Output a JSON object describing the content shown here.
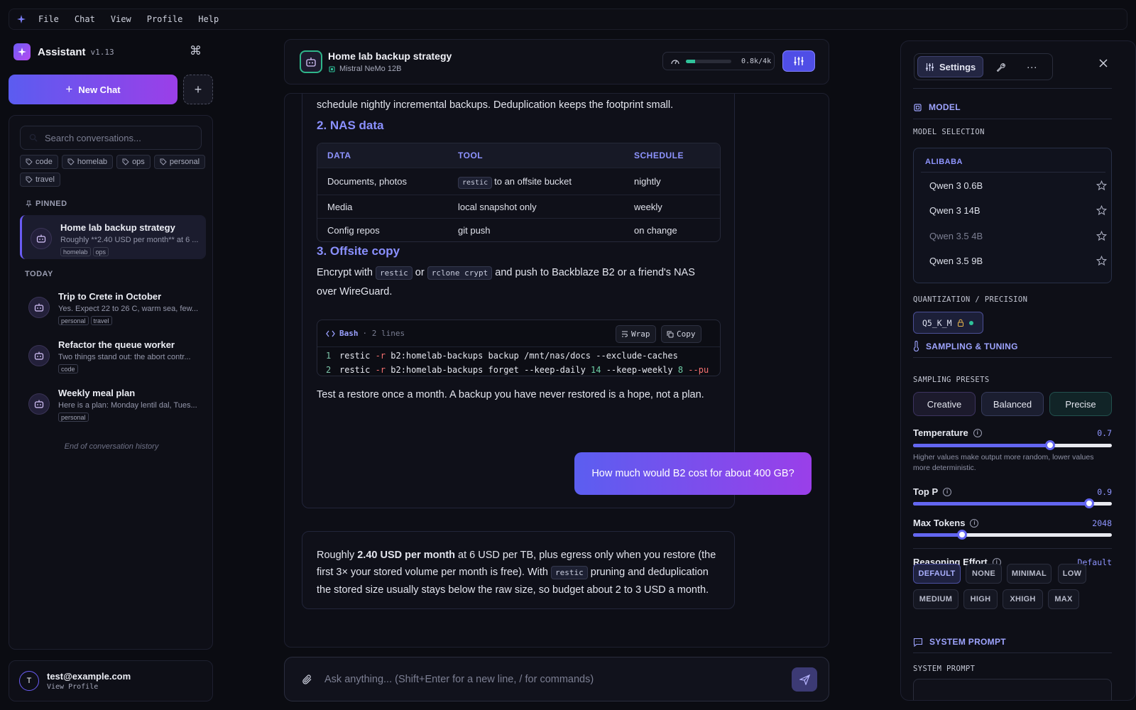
{
  "menubar": {
    "items": [
      "File",
      "Chat",
      "View",
      "Profile",
      "Help"
    ]
  },
  "sidebar": {
    "app_name": "Assistant",
    "version": "v1.13",
    "new_chat_label": "New Chat",
    "search_placeholder": "Search conversations...",
    "tags": [
      "code",
      "homelab",
      "ops",
      "personal",
      "travel"
    ],
    "pinned_label": "PINNED",
    "today_label": "TODAY",
    "pinned": [
      {
        "title": "Home lab backup strategy",
        "preview": "Roughly **2.40 USD per month** at 6 ...",
        "tags": [
          "homelab",
          "ops"
        ]
      }
    ],
    "today": [
      {
        "title": "Trip to Crete in October",
        "preview": "Yes. Expect 22 to 26 C, warm sea, few...",
        "tags": [
          "personal",
          "travel"
        ]
      },
      {
        "title": "Refactor the queue worker",
        "preview": "Two things stand out: the abort contr...",
        "tags": [
          "code"
        ]
      },
      {
        "title": "Weekly meal plan",
        "preview": "Here is a plan: Monday lentil dal, Tues...",
        "tags": [
          "personal"
        ]
      }
    ],
    "end_label": "End of conversation history"
  },
  "profile": {
    "initial": "T",
    "email": "test@example.com",
    "link": "View Profile"
  },
  "chat_header": {
    "title": "Home lab backup strategy",
    "model": "Mistral NeMo 12B",
    "context_label": "0.8k/4k",
    "context_fraction": 0.2
  },
  "message1": {
    "intro_line": "schedule nightly incremental backups. Deduplication keeps the footprint small.",
    "section2_title": "2. NAS data",
    "table": {
      "headers": [
        "DATA",
        "TOOL",
        "SCHEDULE"
      ],
      "rows": [
        {
          "data": "Documents, photos",
          "tool_code": "restic",
          "tool_text": "to an offsite bucket",
          "schedule": "nightly"
        },
        {
          "data": "Media",
          "tool_code": "",
          "tool_text": "local snapshot only",
          "schedule": "weekly"
        },
        {
          "data": "Config repos",
          "tool_code": "",
          "tool_text": "git push",
          "schedule": "on change"
        }
      ]
    },
    "section3_title": "3. Offsite copy",
    "p3": {
      "a": "Encrypt with",
      "code1": "restic",
      "b": "or",
      "code2": "rclone crypt",
      "c": "and push to Backblaze B2 or a friend's NAS",
      "d": "over WireGuard."
    },
    "code_block": {
      "lang": "Bash",
      "lines_label": "· 2 lines",
      "wrap_label": "Wrap",
      "copy_label": "Copy",
      "lines": [
        {
          "n": "1",
          "cmd": "restic ",
          "flag": "-r",
          "rest": " b2:homelab-backups backup /mnt/nas/docs --exclude-caches",
          "num1": "",
          "mid": "",
          "num2": "",
          "tail": ""
        },
        {
          "n": "2",
          "cmd": "restic ",
          "flag": "-r",
          "rest": " b2:homelab-backups forget --keep-daily ",
          "num1": "14",
          "mid": " --keep-weekly ",
          "num2": "8",
          "tail": " --pu"
        }
      ]
    },
    "closing": "Test a restore once a month. A backup you have never restored is a hope, not a plan."
  },
  "user_message": "How much would B2 cost for about 400 GB?",
  "message2": {
    "a": "Roughly ",
    "bold": "2.40 USD per month",
    "b": " at 6 USD per TB, plus egress only when you restore (the first 3× your stored volume per month is free). With ",
    "code": "restic",
    "c": " pruning and deduplication the stored size usually stays below the raw size, so budget about 2 to 3 USD a month."
  },
  "composer": {
    "placeholder": "Ask anything... (Shift+Enter for a new line, / for commands)"
  },
  "settings": {
    "tab_settings": "Settings",
    "model_header": "MODEL",
    "model_selection_label": "MODEL SELECTION",
    "provider": "ALIBABA",
    "models": [
      {
        "name": "Qwen 3 0.6B",
        "dim": false
      },
      {
        "name": "Qwen 3 14B",
        "dim": false
      },
      {
        "name": "Qwen 3.5 4B",
        "dim": true
      },
      {
        "name": "Qwen 3.5 9B",
        "dim": false
      }
    ],
    "quant_label": "QUANTIZATION / PRECISION",
    "quant_value": "Q5_K_M",
    "sampling_header": "SAMPLING & TUNING",
    "presets_label": "SAMPLING PRESETS",
    "presets": [
      "Creative",
      "Balanced",
      "Precise"
    ],
    "temperature": {
      "label": "Temperature",
      "value": "0.7",
      "fraction": 0.69,
      "hint": "Higher values make output more random, lower values more deterministic."
    },
    "top_p": {
      "label": "Top P",
      "value": "0.9",
      "fraction": 0.885
    },
    "max_tokens": {
      "label": "Max Tokens",
      "value": "2048",
      "fraction": 0.245
    },
    "reasoning_label": "Reasoning Effort",
    "reasoning_value": "Default",
    "reasoning_options": [
      "DEFAULT",
      "NONE",
      "MINIMAL",
      "LOW",
      "MEDIUM",
      "HIGH",
      "XHIGH",
      "MAX"
    ],
    "system_prompt_header": "SYSTEM PROMPT",
    "system_prompt_label": "SYSTEM PROMPT"
  },
  "colors": {
    "accent": "#6366f1",
    "accent_gradient_end": "#9b3fe8",
    "success": "#2fc39a",
    "heading": "#8a90ff"
  }
}
